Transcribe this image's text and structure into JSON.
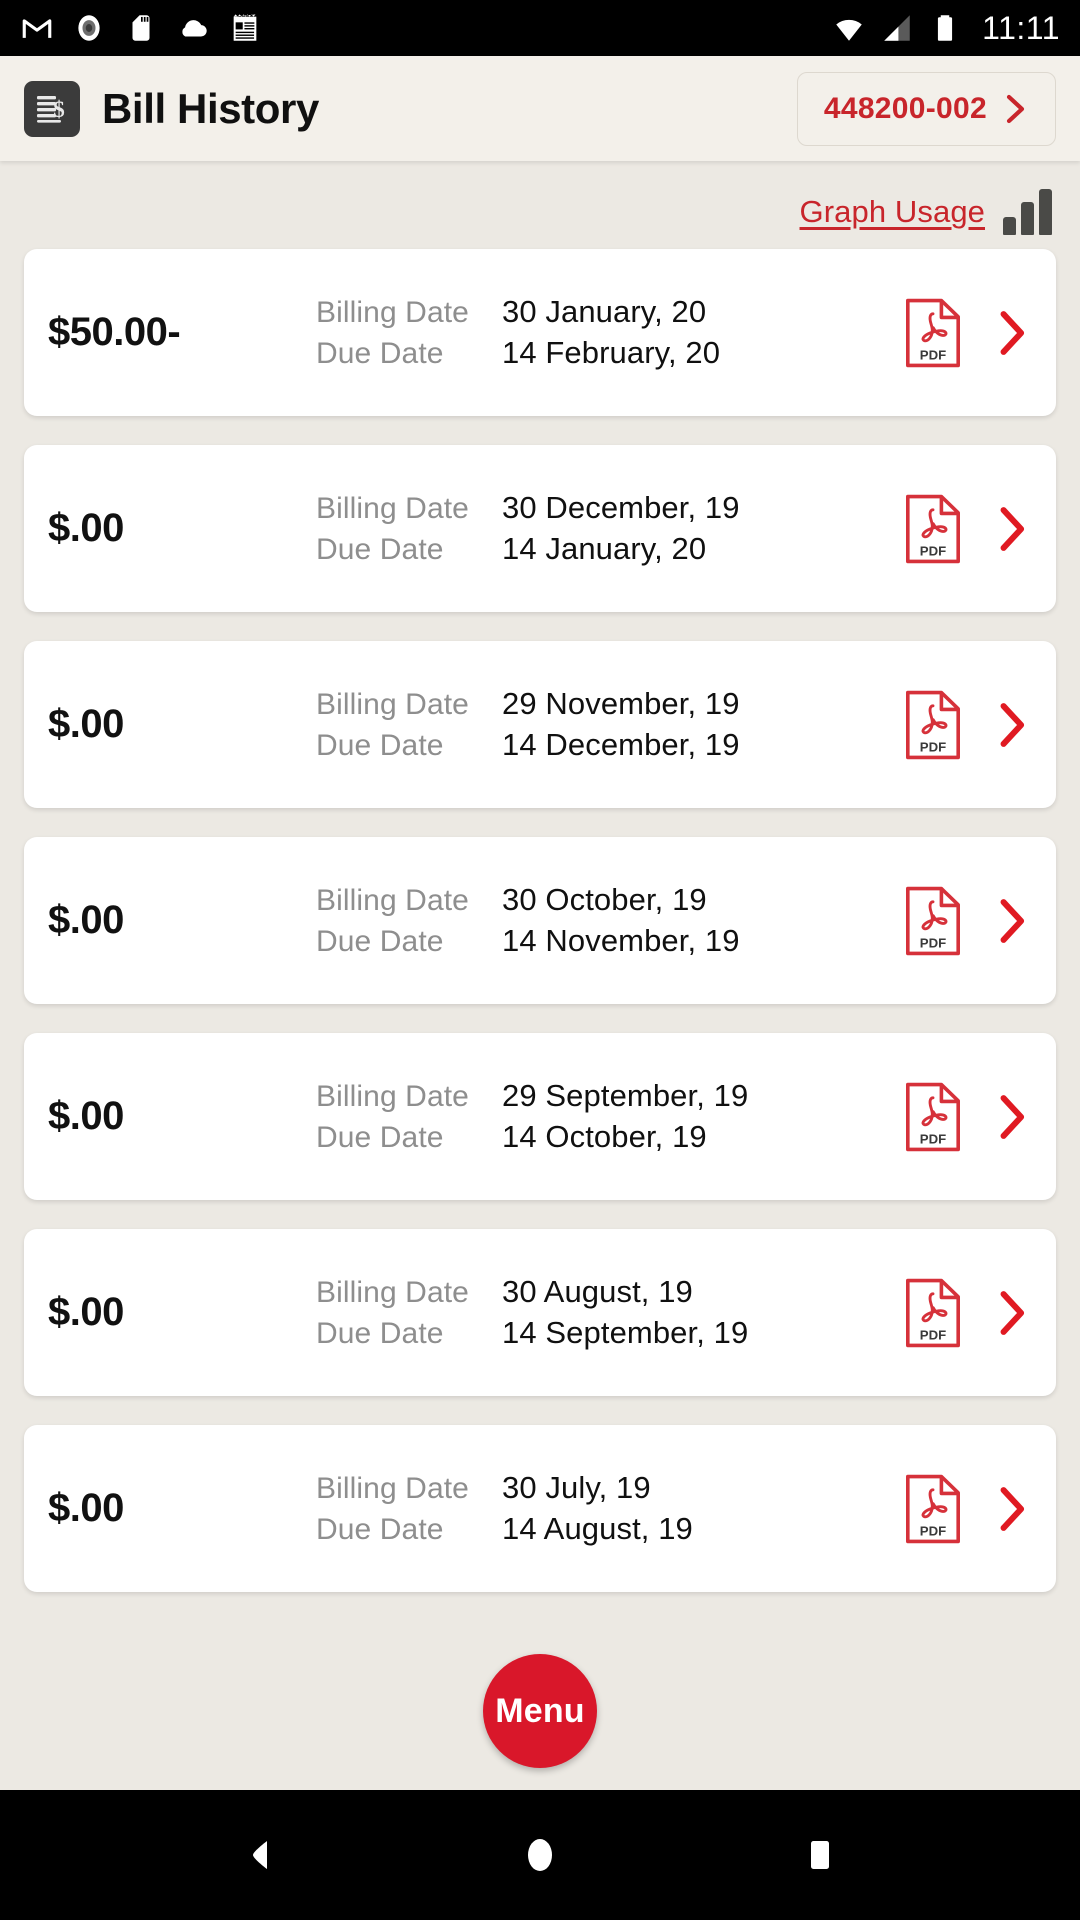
{
  "status_bar": {
    "time": "11:11",
    "left_icons": [
      "gmail-icon",
      "record-icon",
      "sd-card-icon",
      "cloud-icon",
      "notepad-icon"
    ],
    "right_icons": [
      "wifi-icon",
      "cellular-signal-icon",
      "battery-icon"
    ]
  },
  "header": {
    "title": "Bill History",
    "icon": "bill-document-icon",
    "account_number": "448200-002",
    "account_chevron": "chevron-right-icon"
  },
  "toolbar": {
    "graph_usage_label": "Graph Usage",
    "graph_icon": "bar-chart-icon"
  },
  "labels": {
    "billing_date": "Billing Date",
    "due_date": "Due Date"
  },
  "bills": [
    {
      "amount": "$50.00-",
      "billing_date": "30 January, 20",
      "due_date": "14 February, 20"
    },
    {
      "amount": "$.00",
      "billing_date": "30 December, 19",
      "due_date": "14 January, 20"
    },
    {
      "amount": "$.00",
      "billing_date": "29 November, 19",
      "due_date": "14 December, 19"
    },
    {
      "amount": "$.00",
      "billing_date": "30 October, 19",
      "due_date": "14 November, 19"
    },
    {
      "amount": "$.00",
      "billing_date": "29 September, 19",
      "due_date": "14 October, 19"
    },
    {
      "amount": "$.00",
      "billing_date": "30 August, 19",
      "due_date": "14 September, 19"
    },
    {
      "amount": "$.00",
      "billing_date": "30 July, 19",
      "due_date": "14 August, 19"
    }
  ],
  "fab": {
    "label": "Menu"
  },
  "nav_bar": {
    "back": "back-triangle-icon",
    "home": "home-circle-icon",
    "recents": "recents-square-icon"
  },
  "colors": {
    "accent_red": "#c8252b",
    "fab_red": "#d9172a",
    "page_bg": "#ece9e3",
    "header_bg": "#f3f0ea",
    "card_bg": "#ffffff",
    "label_gray": "#8e8e8e",
    "icon_dark": "#3b3b3b"
  }
}
